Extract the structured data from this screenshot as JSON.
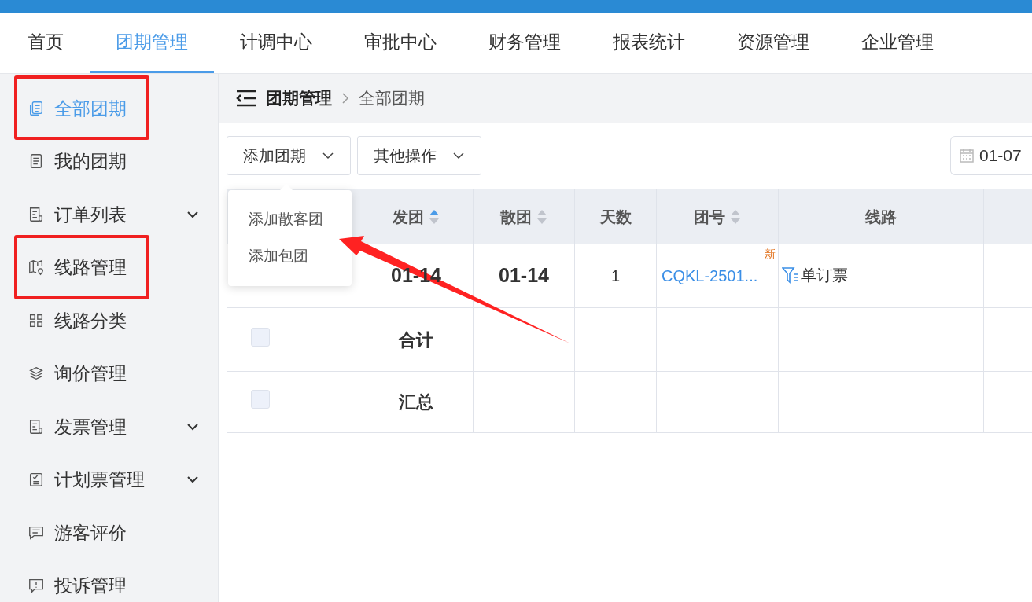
{
  "nav": [
    {
      "label": "首页",
      "selected": false
    },
    {
      "label": "团期管理",
      "selected": true
    },
    {
      "label": "计调中心",
      "selected": false
    },
    {
      "label": "审批中心",
      "selected": false
    },
    {
      "label": "财务管理",
      "selected": false
    },
    {
      "label": "报表统计",
      "selected": false
    },
    {
      "label": "资源管理",
      "selected": false
    },
    {
      "label": "企业管理",
      "selected": false
    }
  ],
  "sidebar": {
    "items": [
      {
        "label": "全部团期",
        "selected": true,
        "expandable": false,
        "highlighted": true
      },
      {
        "label": "我的团期",
        "selected": false,
        "expandable": false,
        "highlighted": false
      },
      {
        "label": "订单列表",
        "selected": false,
        "expandable": true,
        "highlighted": false
      },
      {
        "label": "线路管理",
        "selected": false,
        "expandable": false,
        "highlighted": true
      },
      {
        "label": "线路分类",
        "selected": false,
        "expandable": false,
        "highlighted": false
      },
      {
        "label": "询价管理",
        "selected": false,
        "expandable": false,
        "highlighted": false
      },
      {
        "label": "发票管理",
        "selected": false,
        "expandable": true,
        "highlighted": false
      },
      {
        "label": "计划票管理",
        "selected": false,
        "expandable": true,
        "highlighted": false
      },
      {
        "label": "游客评价",
        "selected": false,
        "expandable": false,
        "highlighted": false
      },
      {
        "label": "投诉管理",
        "selected": false,
        "expandable": false,
        "highlighted": false
      }
    ]
  },
  "breadcrumb": [
    "团期管理",
    "全部团期"
  ],
  "toolbar": {
    "buttons": [
      "添加团期",
      "其他操作"
    ],
    "date_field": "01-07"
  },
  "dropdown": {
    "items": [
      "添加散客团",
      "添加包团"
    ]
  },
  "table": {
    "columns": [
      {
        "kind": "check"
      },
      {
        "kind": "blank"
      },
      {
        "kind": "text",
        "label": "发团",
        "sorted": true
      },
      {
        "kind": "text",
        "label": "散团",
        "sorted": false
      },
      {
        "kind": "text",
        "label": "天数"
      },
      {
        "kind": "text",
        "label": "团号",
        "sorted": false
      },
      {
        "kind": "text",
        "label": "线路"
      },
      {
        "kind": "blank"
      }
    ],
    "rows": [
      {
        "depart": "01-14",
        "end": "01-14",
        "days": "1",
        "group_no": "CQKL-2501...",
        "badge": "新",
        "route": "单订票"
      },
      {
        "checked": false,
        "depart": "合计"
      },
      {
        "checked": false,
        "depart": "汇总"
      }
    ]
  },
  "annotation": {
    "arrow": true
  }
}
